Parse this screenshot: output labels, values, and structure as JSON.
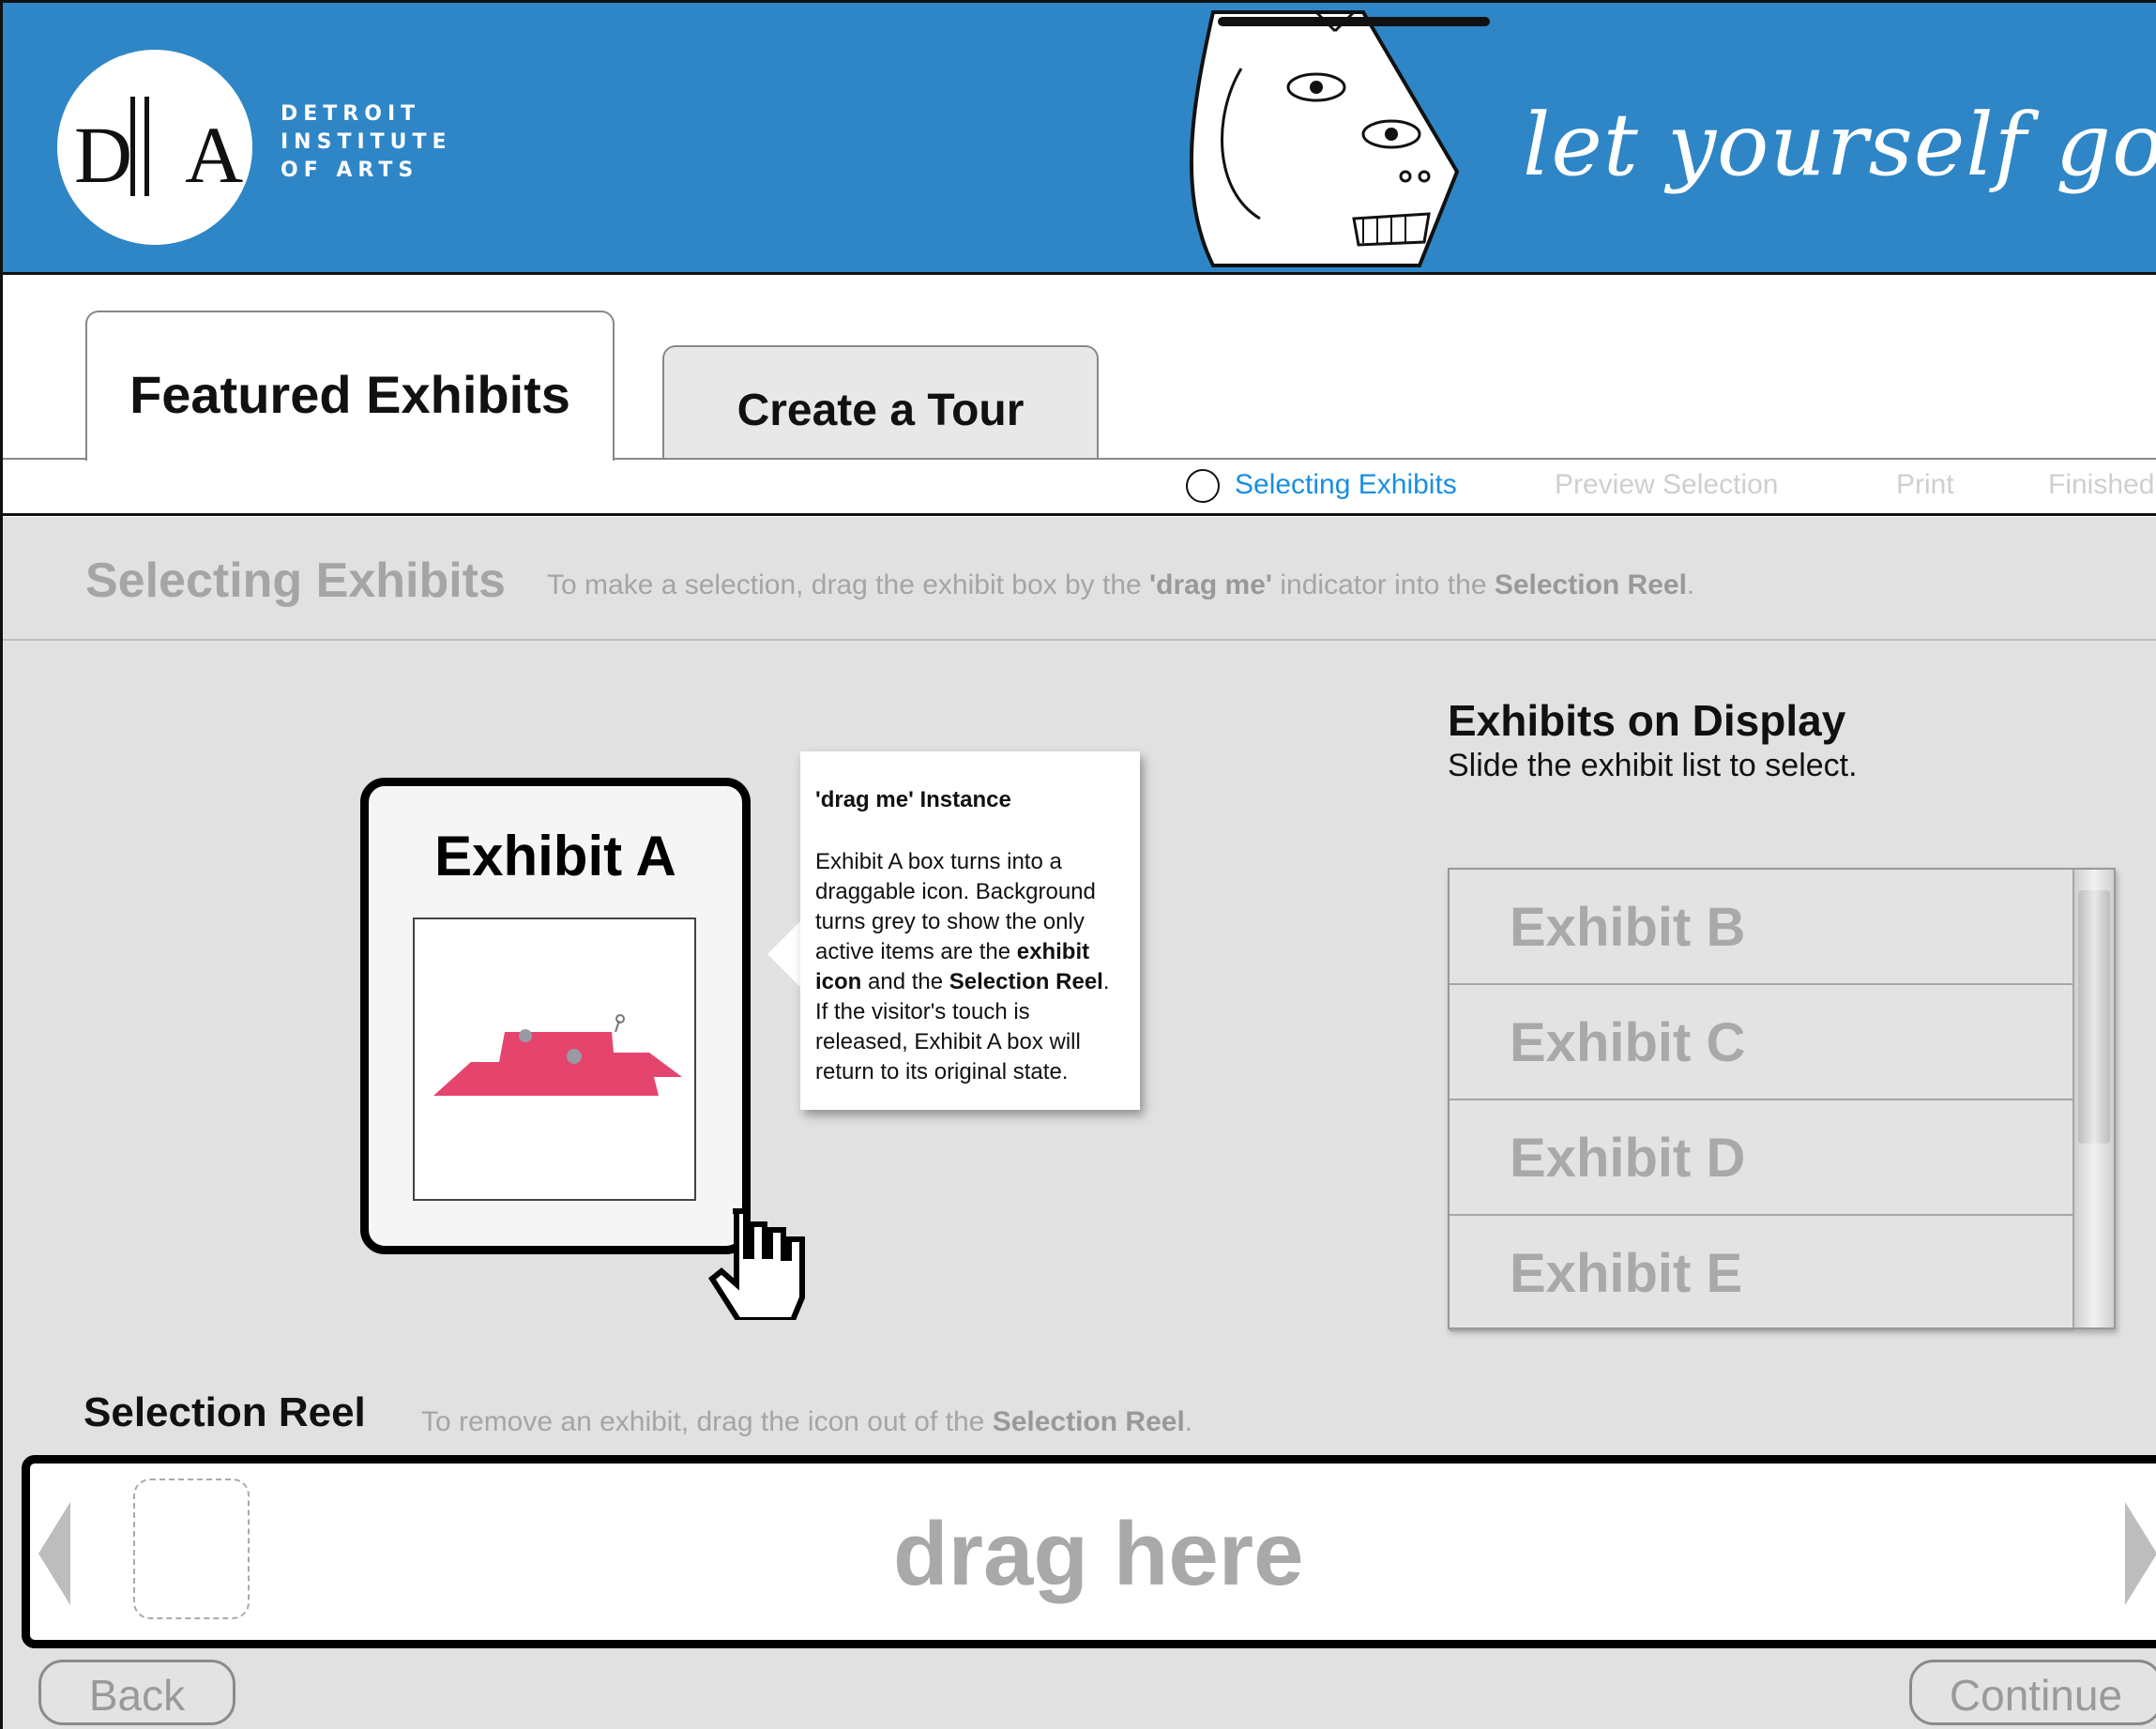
{
  "brand": {
    "logo_mark": "DA",
    "logo_lines": [
      "DETROIT",
      "INSTITUTE",
      "OF ARTS"
    ],
    "tagline": "let yourself go"
  },
  "tabs": [
    {
      "label": "Featured Exhibits",
      "active": true
    },
    {
      "label": "Create a Tour",
      "active": false
    }
  ],
  "steps": [
    {
      "label": "Selecting Exhibits",
      "state": "current"
    },
    {
      "label": "Preview Selection",
      "state": "disabled"
    },
    {
      "label": "Print",
      "state": "disabled"
    },
    {
      "label": "Finished",
      "state": "disabled"
    }
  ],
  "instructions": {
    "title": "Selecting Exhibits",
    "text_pre": "To make a selection, drag the exhibit box by the ",
    "text_bold1": "'drag me'",
    "text_mid": " indicator into the ",
    "text_bold2": "Selection Reel",
    "text_post": "."
  },
  "exhibit_card": {
    "title": "Exhibit A",
    "image_icon": "exhibit-artwork-image"
  },
  "callout": {
    "title": "'drag me' Instance",
    "p1": "Exhibit A box turns into a draggable icon. Background turns grey to show the only active items are the ",
    "b1": "exhibit icon",
    "p2": " and the ",
    "b2": "Selection Reel",
    "p3": ". If the visitor's touch is released, Exhibit A box will return to its original state."
  },
  "display": {
    "title": "Exhibits on Display",
    "subtitle": "Slide the exhibit list to select.",
    "items": [
      "Exhibit B",
      "Exhibit C",
      "Exhibit D",
      "Exhibit E"
    ]
  },
  "reel": {
    "title": "Selection Reel",
    "instr_pre": "To remove an exhibit, drag the icon out of the ",
    "instr_bold": "Selection Reel",
    "instr_post": ".",
    "placeholder": "drag here"
  },
  "buttons": {
    "back": "Back",
    "continue": "Continue"
  },
  "colors": {
    "banner": "#2e86c6",
    "active_step": "#1a8fe0",
    "disabled_text": "#a9a9a9",
    "artwork": "#e5446d"
  },
  "icons": [
    "hand-cursor-icon",
    "circle-step-icon",
    "chevron-left-icon",
    "chevron-right-icon"
  ]
}
